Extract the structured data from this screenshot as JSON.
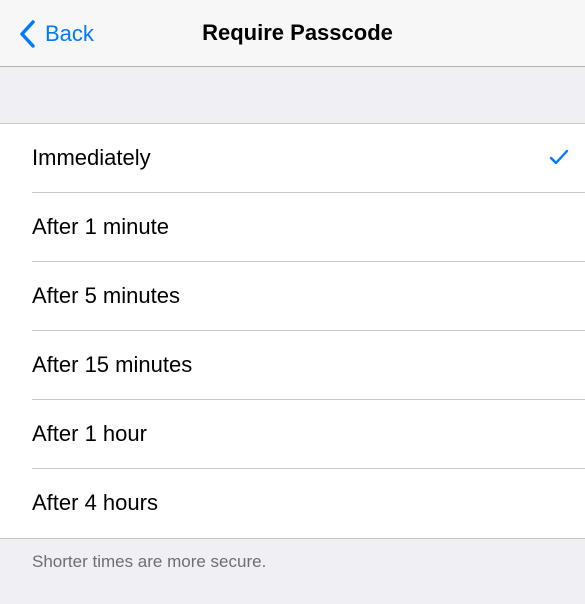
{
  "navbar": {
    "back_label": "Back",
    "title": "Require Passcode"
  },
  "options": [
    {
      "label": "Immediately",
      "selected": true
    },
    {
      "label": "After 1 minute",
      "selected": false
    },
    {
      "label": "After 5 minutes",
      "selected": false
    },
    {
      "label": "After 15 minutes",
      "selected": false
    },
    {
      "label": "After 1 hour",
      "selected": false
    },
    {
      "label": "After 4 hours",
      "selected": false
    }
  ],
  "footer": {
    "note": "Shorter times are more secure."
  },
  "colors": {
    "accent": "#007aff",
    "background": "#efeff4",
    "footer_text": "#6d6d72"
  },
  "icons": {
    "back": "chevron-left-icon",
    "selected": "checkmark-icon"
  }
}
